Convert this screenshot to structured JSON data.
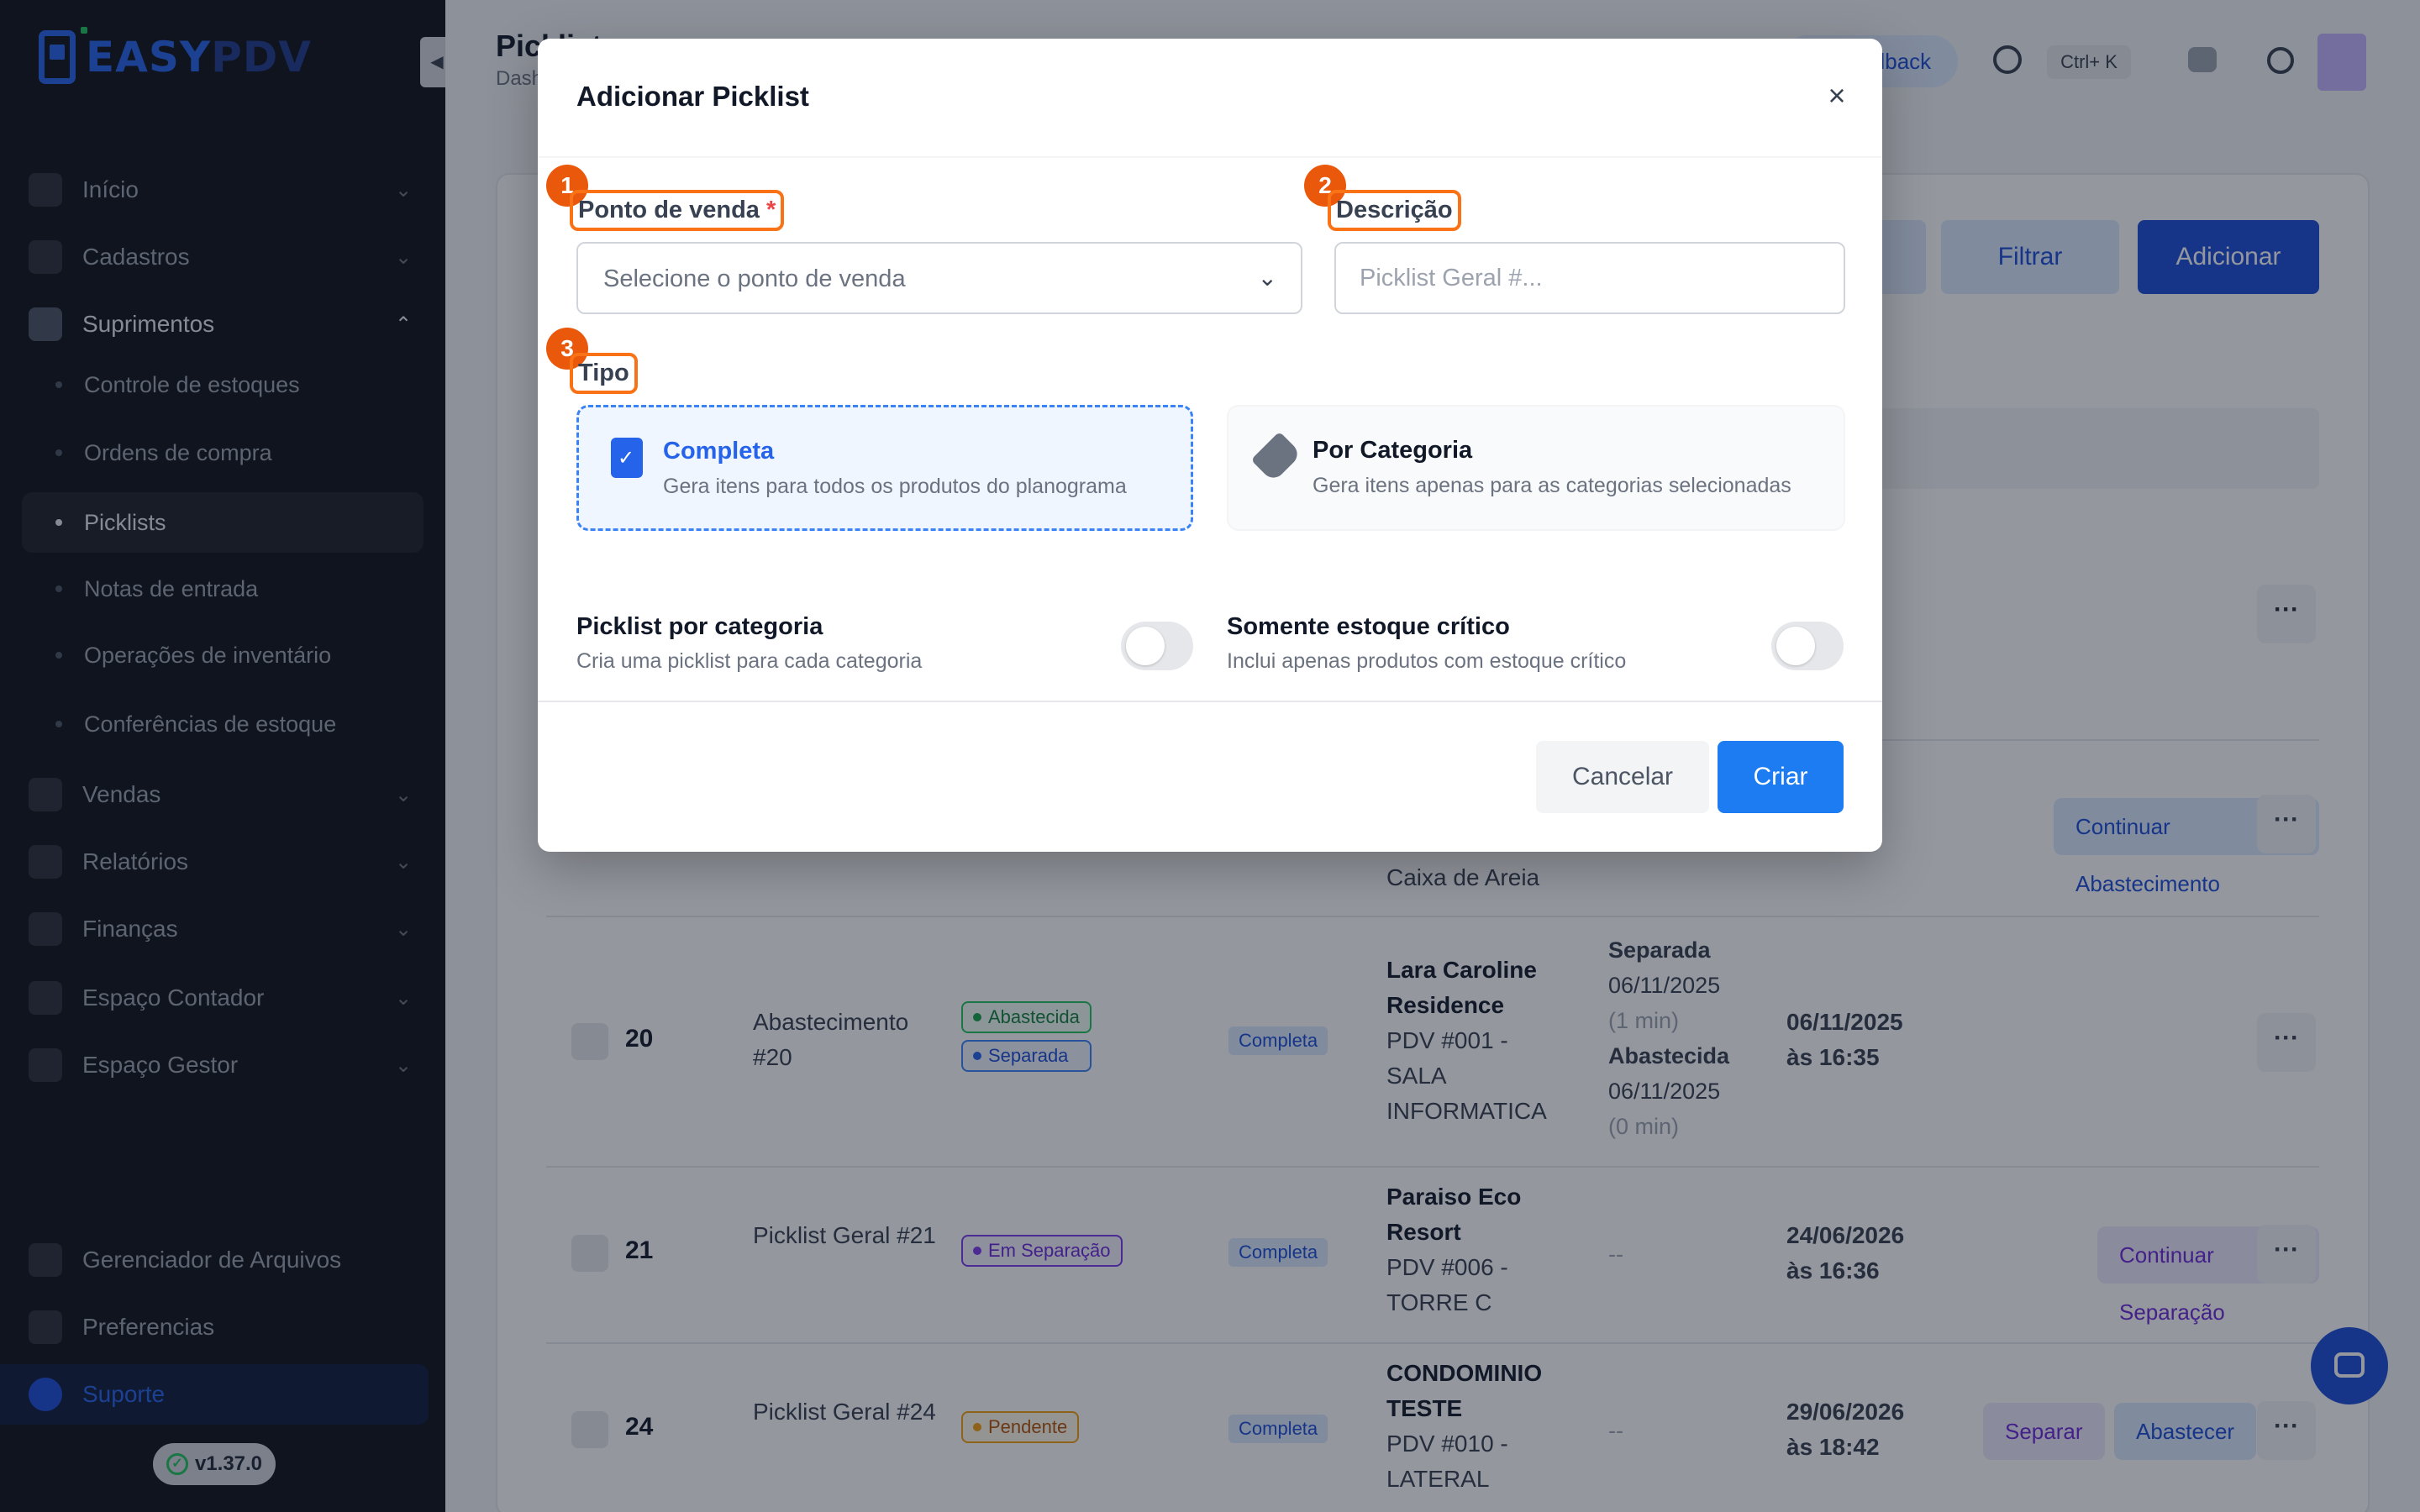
{
  "app": {
    "logo_easy": "EASY",
    "logo_pdv": "PDV",
    "version": "v1.37.0"
  },
  "sidebar": {
    "items": [
      {
        "label": "Início",
        "icon": "grid-icon"
      },
      {
        "label": "Cadastros",
        "icon": "list-icon"
      },
      {
        "label": "Suprimentos",
        "icon": "box-icon"
      },
      {
        "label": "Vendas",
        "icon": "calendar-icon"
      },
      {
        "label": "Relatórios",
        "icon": "chart-icon"
      },
      {
        "label": "Finanças",
        "icon": "dollar-icon"
      },
      {
        "label": "Espaço Contador",
        "icon": "briefcase-icon"
      },
      {
        "label": "Espaço Gestor",
        "icon": "users-icon"
      },
      {
        "label": "Gerenciador de Arquivos",
        "icon": "folder-icon"
      },
      {
        "label": "Preferencias",
        "icon": "sliders-icon"
      },
      {
        "label": "Suporte",
        "icon": "help-icon"
      }
    ],
    "sub_items": [
      {
        "label": "Controle de estoques"
      },
      {
        "label": "Ordens de compra"
      },
      {
        "label": "Picklists"
      },
      {
        "label": "Notas de entrada"
      },
      {
        "label": "Operações de inventário"
      },
      {
        "label": "Conferências de estoque"
      }
    ]
  },
  "header": {
    "title": "Picklists",
    "breadcrumb": "Dashboard",
    "feedback": "Feedback",
    "shortcut": "Ctrl+ K"
  },
  "toolbar": {
    "filter": "Filtrar",
    "add": "Adicionar"
  },
  "table": {
    "rows": [
      {
        "pdv_tail": "Caixa de Areia",
        "action": "Continuar Abastecimento"
      },
      {
        "num": "20",
        "name": "Abastecimento #20",
        "badges": [
          "Abastecida",
          "Separada"
        ],
        "tipo": "Completa",
        "pdv_name": "Lara Caroline Residence",
        "pdv_code": "PDV #001 - SALA INFORMATICA",
        "p1_label": "Separada",
        "p1_date": "06/11/2025",
        "p1_dur": "(1 min)",
        "p2_label": "Abastecida",
        "p2_date": "06/11/2025",
        "p2_dur": "(0 min)",
        "date1": "06/11/2025",
        "date2": "às 16:35"
      },
      {
        "num": "21",
        "name": "Picklist Geral #21",
        "badges": [
          "Em Separação"
        ],
        "tipo": "Completa",
        "pdv_name": "Paraiso Eco Resort",
        "pdv_code": "PDV #006 - TORRE C",
        "progress": "--",
        "date1": "24/06/2026",
        "date2": "às 16:36",
        "action": "Continuar Separação"
      },
      {
        "num": "24",
        "name": "Picklist Geral #24",
        "badges": [
          "Pendente"
        ],
        "tipo": "Completa",
        "pdv_name": "CONDOMINIO TESTE",
        "pdv_code": "PDV #010 - LATERAL",
        "progress": "--",
        "date1": "29/06/2026",
        "date2": "às 18:42",
        "action1": "Separar",
        "action2": "Abastecer"
      }
    ]
  },
  "modal": {
    "title": "Adicionar Picklist",
    "markers": [
      "1",
      "2",
      "3"
    ],
    "pos_label": "Ponto de venda",
    "required_mark": "*",
    "pos_placeholder": "Selecione o ponto de venda",
    "desc_label": "Descrição",
    "desc_placeholder": "Picklist Geral #...",
    "tipo_label": "Tipo",
    "options": [
      {
        "title": "Completa",
        "desc": "Gera itens para todos os produtos do planograma",
        "selected": true
      },
      {
        "title": "Por Categoria",
        "desc": "Gera itens apenas para as categorias selecionadas",
        "selected": false
      }
    ],
    "toggles": [
      {
        "title": "Picklist por categoria",
        "desc": "Cria uma picklist para cada categoria",
        "on": false
      },
      {
        "title": "Somente estoque crítico",
        "desc": "Inclui apenas produtos com estoque crítico",
        "on": false
      }
    ],
    "cancel": "Cancelar",
    "create": "Criar"
  },
  "colors": {
    "accent": "#1d7cf2",
    "highlight": "#f97316",
    "sidebar_bg": "#0f1117"
  }
}
